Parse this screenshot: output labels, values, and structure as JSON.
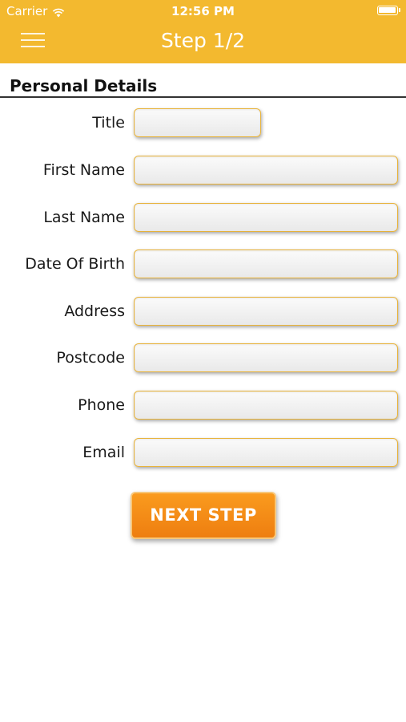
{
  "status_bar": {
    "carrier": "Carrier",
    "time": "12:56 PM",
    "wifi_icon": "wifi-icon",
    "battery_icon": "battery-icon"
  },
  "nav": {
    "title": "Step 1/2",
    "menu_icon": "hamburger-menu-icon"
  },
  "section": {
    "title": "Personal Details"
  },
  "form": {
    "fields": [
      {
        "label": "Title",
        "value": "",
        "placeholder": ""
      },
      {
        "label": "First Name",
        "value": "",
        "placeholder": ""
      },
      {
        "label": "Last Name",
        "value": "",
        "placeholder": ""
      },
      {
        "label": "Date Of Birth",
        "value": "",
        "placeholder": ""
      },
      {
        "label": "Address",
        "value": "",
        "placeholder": ""
      },
      {
        "label": "Postcode",
        "value": "",
        "placeholder": ""
      },
      {
        "label": "Phone",
        "value": "",
        "placeholder": ""
      },
      {
        "label": "Email",
        "value": "",
        "placeholder": ""
      }
    ],
    "submit_label": "NEXT STEP"
  },
  "colors": {
    "header_bg": "#f3b92f",
    "button_bg": "#f58c17",
    "input_border": "#e8b33a"
  }
}
